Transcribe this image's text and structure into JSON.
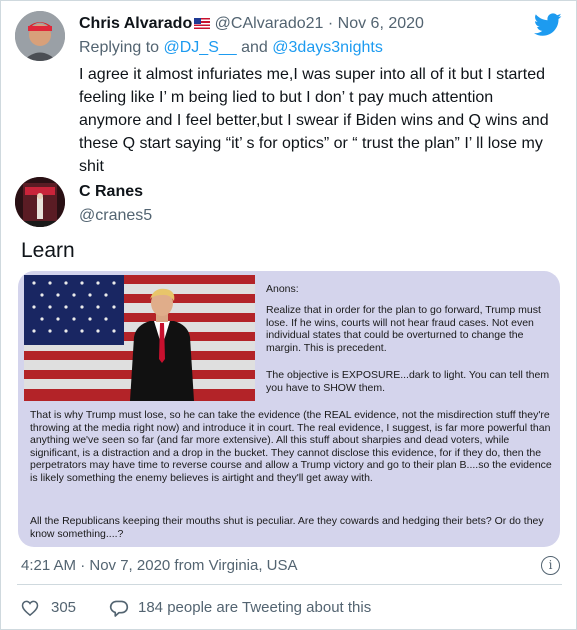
{
  "reply_tweet": {
    "author_name": "Chris Alvarado",
    "author_handle": "@CAlvarado21",
    "date": "Nov 6, 2020",
    "replying_prefix": "Replying to",
    "replying_to_1": "@DJ_S__",
    "replying_and": "and",
    "replying_to_2": "@3days3nights",
    "text": "I agree it almost infuriates me,I was super into all of it but I started feeling like I’ m being lied to but I don’ t pay much attention anymore and I feel better,but I swear if Biden wins and Q wins and these Q start saying “it’ s for optics” or “ trust the plan” I’ ll lose my shit"
  },
  "main_tweet": {
    "author_name": "C Ranes",
    "author_handle": "@cranes5",
    "text": "Learn",
    "timestamp": "4:21 AM · Nov 7, 2020 from Virginia, USA",
    "likes": "305",
    "tweeting_about": "184 people are Tweeting about this"
  },
  "image_card": {
    "heading": "Anons:",
    "p1": "Realize that in order for the plan to go forward, Trump must lose. If he wins, courts will not hear fraud cases. Not even individual states that could be overturned to change the margin. This is precedent.",
    "p2": "The objective is EXPOSURE...dark to light. You can tell them you have to SHOW them.",
    "p3": "That is why Trump must lose, so he can take the evidence (the REAL evidence, not the misdirection stuff they're throwing at the media right now) and introduce it in court. The real evidence, I suggest, is far more powerful than anything we've seen so far (and far more extensive). All this stuff about sharpies and dead voters, while significant, is a distraction and a drop in the bucket. They cannot disclose this evidence, for if they do, then the perpetrators may have time to reverse course and allow a Trump victory and go to their plan B....so the evidence is likely something the enemy believes is airtight and they'll get away with.",
    "p4": "All the Republicans keeping their mouths shut is peculiar. Are they cowards and hedging their bets? Or do they know something....?"
  },
  "icons": [
    "twitter-bird-icon",
    "flag-icon",
    "info-icon",
    "heart-icon",
    "reply-bubble-icon"
  ],
  "colors": {
    "link": "#1d9bf0",
    "muted": "#536471",
    "card_bg": "#d4d4ec"
  }
}
